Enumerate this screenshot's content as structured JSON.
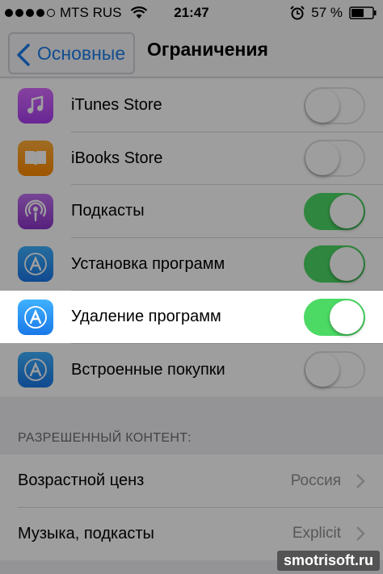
{
  "status_bar": {
    "carrier": "MTS RUS",
    "time": "21:47",
    "battery": "57 %",
    "signal_dots_filled": 4,
    "signal_dots_total": 5
  },
  "nav": {
    "back_label": "Основные",
    "title": "Ограничения"
  },
  "apps": [
    {
      "label": "iTunes Store",
      "icon": "music-note-icon",
      "enabled": false
    },
    {
      "label": "iBooks Store",
      "icon": "book-icon",
      "enabled": false
    },
    {
      "label": "Подкасты",
      "icon": "podcast-icon",
      "enabled": true
    },
    {
      "label": "Установка программ",
      "icon": "app-store-icon",
      "enabled": true
    },
    {
      "label": "Удаление программ",
      "icon": "app-store-icon",
      "enabled": true
    },
    {
      "label": "Встроенные покупки",
      "icon": "app-store-icon",
      "enabled": false
    }
  ],
  "content_section": {
    "header": "РАЗРЕШЕННЫЙ КОНТЕНТ:",
    "rows": [
      {
        "label": "Возрастной ценз",
        "value": "Россия"
      },
      {
        "label": "Музыка, подкасты",
        "value": "Explicit"
      }
    ]
  },
  "watermark": "smotrisoft.ru",
  "colors": {
    "accent_blue": "#1c7ce8",
    "toggle_on": "#4cd964",
    "itunes": "#c644fc",
    "ibooks": "#ff9500",
    "podcasts": "#9b3fd0",
    "appstore": "#1a8cf0"
  }
}
